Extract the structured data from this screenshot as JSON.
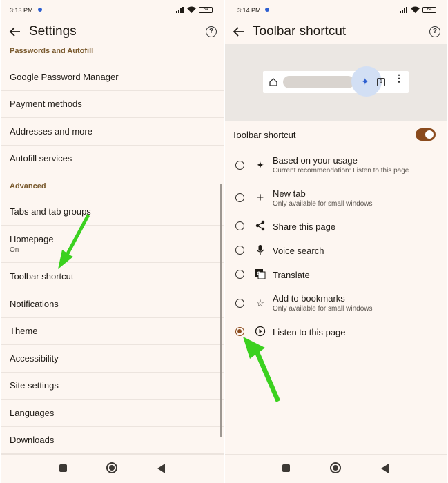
{
  "left": {
    "status": {
      "time": "3:13 PM",
      "battery": "64"
    },
    "title": "Settings",
    "sections": {
      "passwords": "Passwords and Autofill",
      "advanced": "Advanced"
    },
    "items": [
      {
        "label": "Google Password Manager"
      },
      {
        "label": "Payment methods"
      },
      {
        "label": "Addresses and more"
      },
      {
        "label": "Autofill services"
      },
      {
        "label": "Tabs and tab groups"
      },
      {
        "label": "Homepage",
        "sub": "On"
      },
      {
        "label": "Toolbar shortcut"
      },
      {
        "label": "Notifications"
      },
      {
        "label": "Theme"
      },
      {
        "label": "Accessibility"
      },
      {
        "label": "Site settings"
      },
      {
        "label": "Languages"
      },
      {
        "label": "Downloads"
      }
    ]
  },
  "right": {
    "status": {
      "time": "3:14 PM",
      "battery": "64"
    },
    "title": "Toolbar shortcut",
    "preview": {
      "tab_count": "1"
    },
    "toggle": {
      "label": "Toolbar shortcut",
      "on": true
    },
    "options": [
      {
        "label": "Based on your usage",
        "sub": "Current recommendation:  Listen to this page",
        "icon": "sparkle-icon",
        "selected": false
      },
      {
        "label": "New tab",
        "sub": "Only available for small windows",
        "icon": "plus-icon",
        "selected": false
      },
      {
        "label": "Share this page",
        "sub": "",
        "icon": "share-icon",
        "selected": false
      },
      {
        "label": "Voice search",
        "sub": "",
        "icon": "mic-icon",
        "selected": false
      },
      {
        "label": "Translate",
        "sub": "",
        "icon": "translate-icon",
        "selected": false
      },
      {
        "label": "Add to bookmarks",
        "sub": "Only available for small windows",
        "icon": "star-icon",
        "selected": false
      },
      {
        "label": "Listen to this page",
        "sub": "",
        "icon": "play-circle-icon",
        "selected": true
      }
    ]
  },
  "colors": {
    "background": "#fdf6f1",
    "accent": "#8a4a1c",
    "section_header": "#7a5a2e",
    "annotation_arrow": "#3bd11f"
  }
}
